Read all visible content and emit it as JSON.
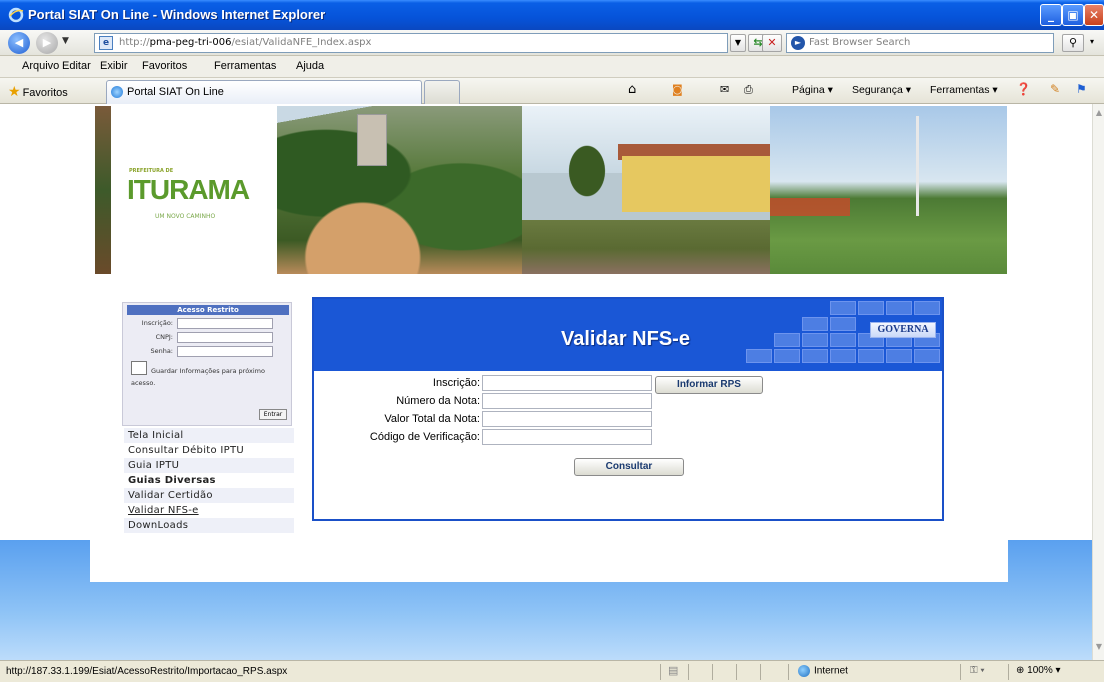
{
  "window": {
    "title": "Portal SIAT On Line - Windows Internet Explorer"
  },
  "address_bar": {
    "url_prefix": "http://",
    "url_host": "pma-peg-tri-006",
    "url_path": "/esiat/ValidaNFE_Index.aspx",
    "search_placeholder": "Fast Browser Search"
  },
  "menu": [
    "Arquivo",
    "Editar",
    "Exibir",
    "Favoritos",
    "Ferramentas",
    "Ajuda"
  ],
  "favorites_bar": {
    "favorites_label": "Favoritos",
    "tab_label": "Portal SIAT On Line",
    "commands": [
      "Página ▾",
      "Segurança ▾",
      "Ferramentas ▾"
    ]
  },
  "banner": {
    "logo_prefix": "PREFEITURA DE",
    "logo_name": "ITURAMA",
    "logo_tagline": "UM NOVO CAMINHO"
  },
  "login": {
    "header": "Acesso Restrito",
    "fields": [
      "Inscrição:",
      "CNPJ:",
      "Senha:"
    ],
    "remember_label": "Guardar Informações para próximo acesso.",
    "submit_label": "Entrar"
  },
  "side_menu": [
    {
      "label": "Tela Inicial"
    },
    {
      "label": "Consultar Débito IPTU"
    },
    {
      "label": "Guia IPTU"
    },
    {
      "label": "Guias Diversas"
    },
    {
      "label": "Validar Certidão"
    },
    {
      "label": "Validar NFS-e"
    },
    {
      "label": "DownLoads"
    }
  ],
  "panel": {
    "title": "Validar NFS-e",
    "brand": "GOVERNA",
    "fields": [
      {
        "label": "Inscrição:",
        "value": ""
      },
      {
        "label": "Número da Nota:",
        "value": ""
      },
      {
        "label": "Valor Total da Nota:",
        "value": ""
      },
      {
        "label": "Código de Verificação:",
        "value": ""
      }
    ],
    "informar_rps_label": "Informar RPS",
    "consultar_label": "Consultar"
  },
  "status_bar": {
    "url": "http://187.33.1.199/Esiat/AcessoRestrito/Importacao_RPS.aspx",
    "zone": "Internet",
    "zoom": "100%"
  },
  "colors": {
    "title_bar": "#0653D9",
    "panel_header": "#1a57d6",
    "panel_border": "#1a50c8",
    "page_blue_bottom": "#5aa0ef"
  }
}
